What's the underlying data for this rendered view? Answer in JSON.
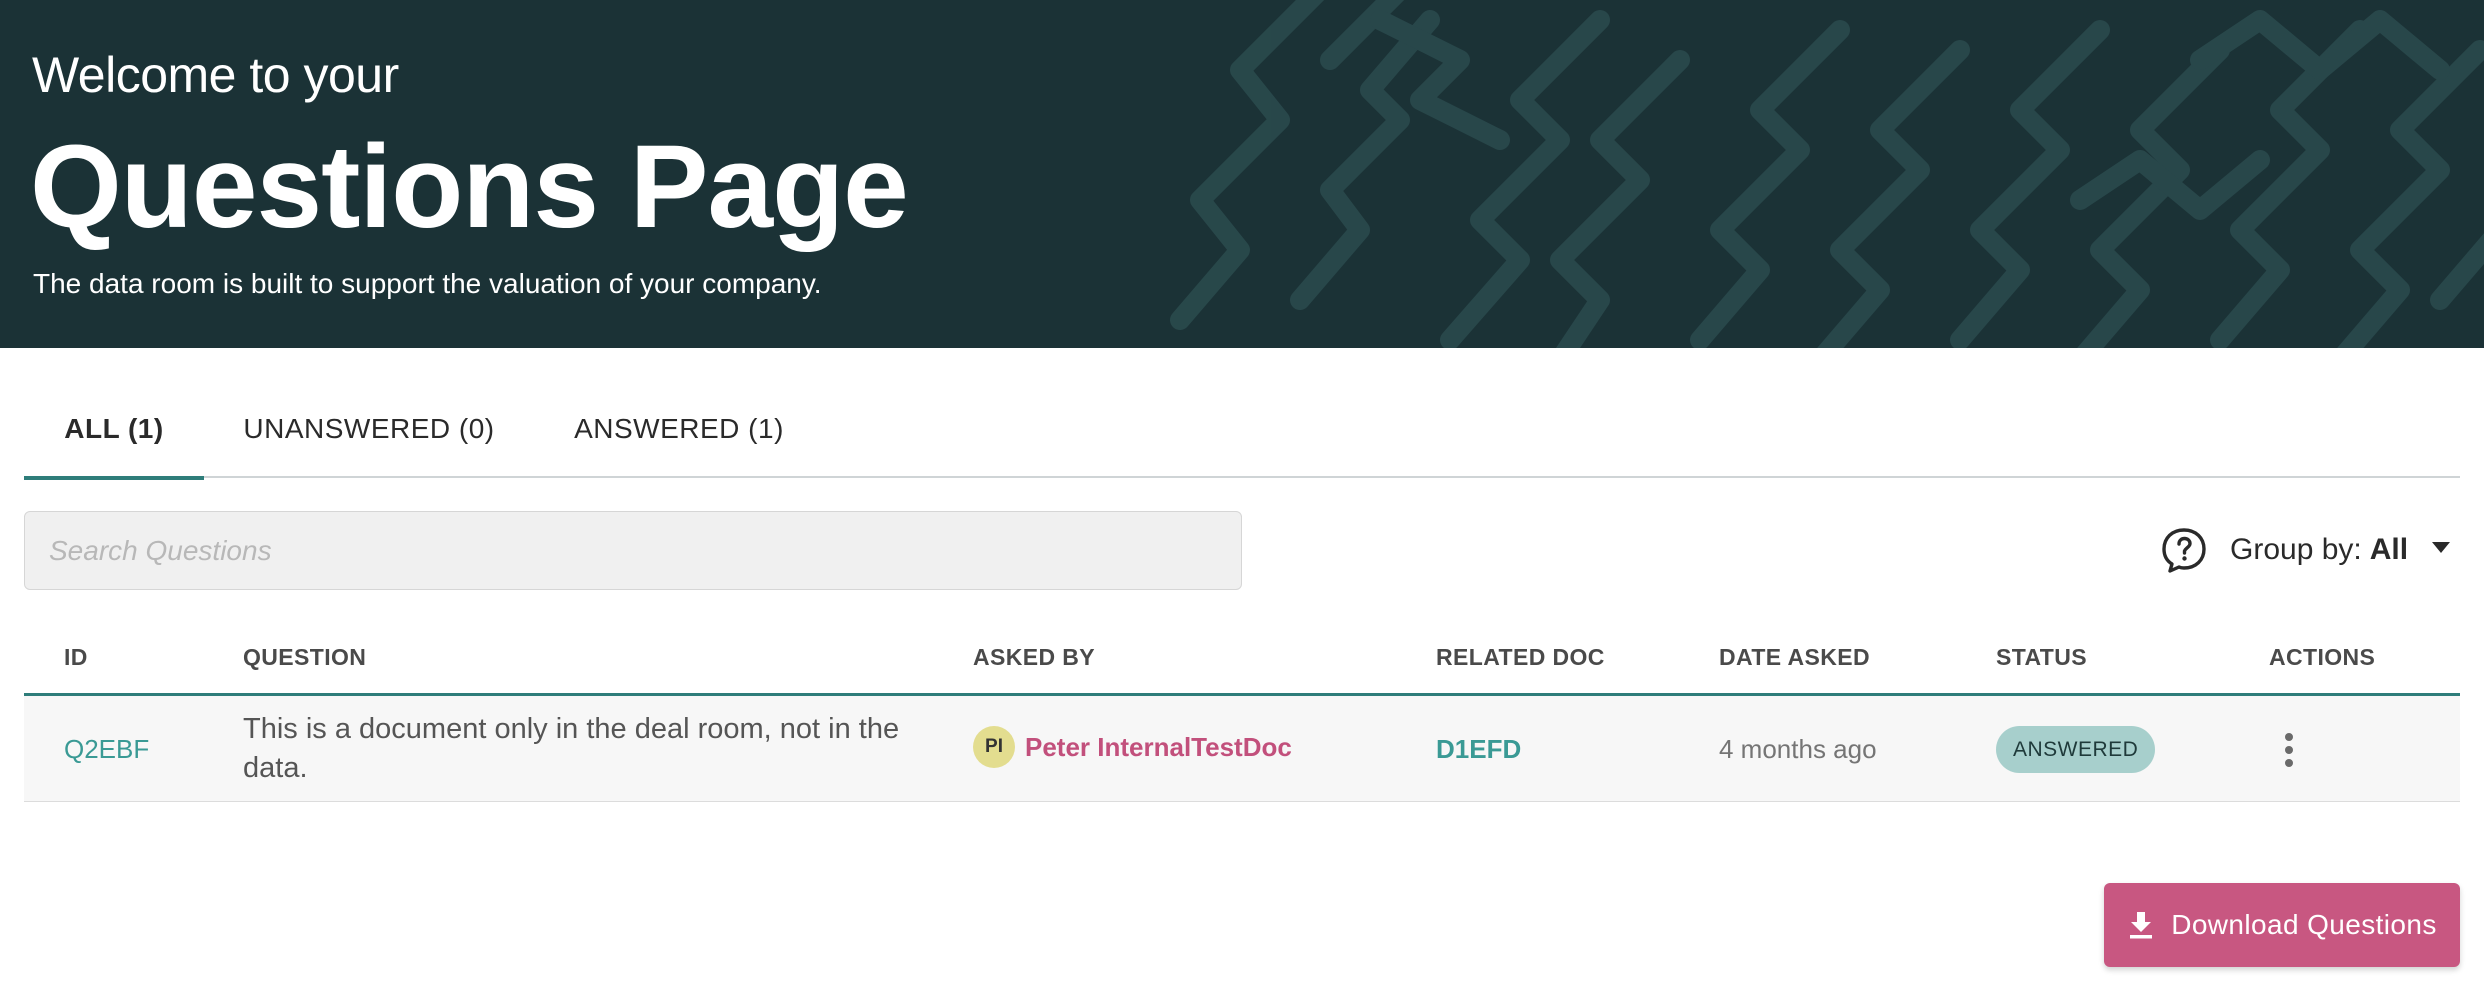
{
  "hero": {
    "welcome": "Welcome to your",
    "title": "Questions Page",
    "subtitle": "The data room is built to support the valuation of your company.",
    "background_color": "#1b3236"
  },
  "tabs": [
    {
      "label": "ALL (1)",
      "active": true
    },
    {
      "label": "UNANSWERED (0)",
      "active": false
    },
    {
      "label": "ANSWERED (1)",
      "active": false
    }
  ],
  "search": {
    "placeholder": "Search Questions",
    "value": ""
  },
  "group_by": {
    "icon": "question-bubble-icon",
    "label": "Group by:",
    "value": "All"
  },
  "table": {
    "columns": [
      "ID",
      "QUESTION",
      "ASKED BY",
      "RELATED DOC",
      "DATE ASKED",
      "STATUS",
      "ACTIONS"
    ],
    "rows": [
      {
        "id": "Q2EBF",
        "question": "This is a document only in the deal room, not in the data.",
        "asked_by_initials": "PI",
        "asked_by": "Peter InternalTestDoc",
        "related_doc": "D1EFD",
        "date_asked": "4 months ago",
        "status": "ANSWERED",
        "actions_icon": "more-vert-icon"
      }
    ]
  },
  "download": {
    "label": "Download Questions",
    "icon": "download-icon"
  },
  "colors": {
    "accent_teal": "#2e7d7a",
    "link_teal": "#3a9a95",
    "brand_pink": "#c85781",
    "status_badge": "#a7cfcc"
  }
}
